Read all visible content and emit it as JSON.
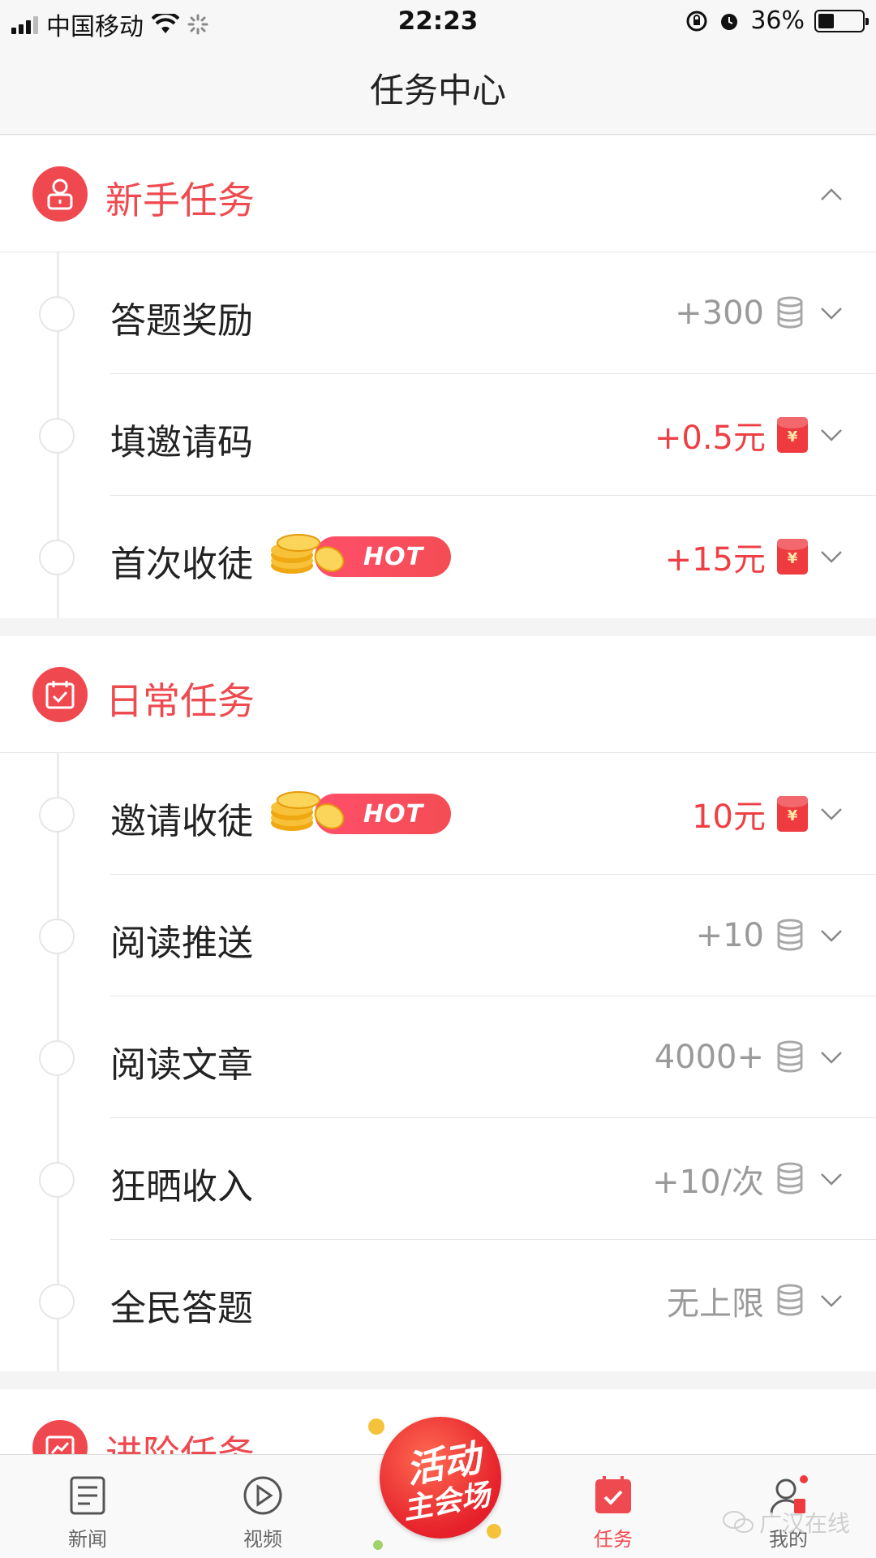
{
  "status_bar": {
    "carrier": "中国移动",
    "time": "22:23",
    "battery": "36%"
  },
  "nav": {
    "title": "任务中心"
  },
  "sections": [
    {
      "title": "新手任务",
      "items": [
        {
          "label": "答题奖励",
          "reward": "+300",
          "reward_icon": "coins-icon",
          "reward_color": "#9a9a9a"
        },
        {
          "label": "填邀请码",
          "reward": "+0.5元",
          "reward_icon": "red-packet-icon",
          "reward_color": "#ef3f44"
        },
        {
          "label": "首次收徒",
          "badge": "HOT",
          "reward": "+15元",
          "reward_icon": "red-packet-icon",
          "reward_color": "#ef3f44"
        }
      ]
    },
    {
      "title": "日常任务",
      "items": [
        {
          "label": "邀请收徒",
          "badge": "HOT",
          "reward": "10元",
          "reward_icon": "red-packet-icon",
          "reward_color": "#ef3f44"
        },
        {
          "label": "阅读推送",
          "reward": "+10",
          "reward_icon": "coins-icon",
          "reward_color": "#9a9a9a"
        },
        {
          "label": "阅读文章",
          "reward": "4000+",
          "reward_icon": "coins-icon",
          "reward_color": "#9a9a9a"
        },
        {
          "label": "狂晒收入",
          "reward": "+10/次",
          "reward_icon": "coins-icon",
          "reward_color": "#9a9a9a"
        },
        {
          "label": "全民答题",
          "reward": "无上限",
          "reward_icon": "coins-icon",
          "reward_color": "#9a9a9a"
        }
      ]
    },
    {
      "title": "进阶任务"
    }
  ],
  "red_packet_symbol": "¥",
  "promo": {
    "line1": "活动",
    "line2": "主会场"
  },
  "tabs": [
    {
      "label": "新闻",
      "icon": "news-icon"
    },
    {
      "label": "视频",
      "icon": "video-icon"
    },
    {
      "label": "任务",
      "icon": "task-icon",
      "active": true
    },
    {
      "label": "我的",
      "icon": "profile-icon"
    }
  ],
  "watermark": "广汉在线",
  "colors": {
    "accent": "#ef4a4f",
    "muted": "#9a9a9a"
  }
}
